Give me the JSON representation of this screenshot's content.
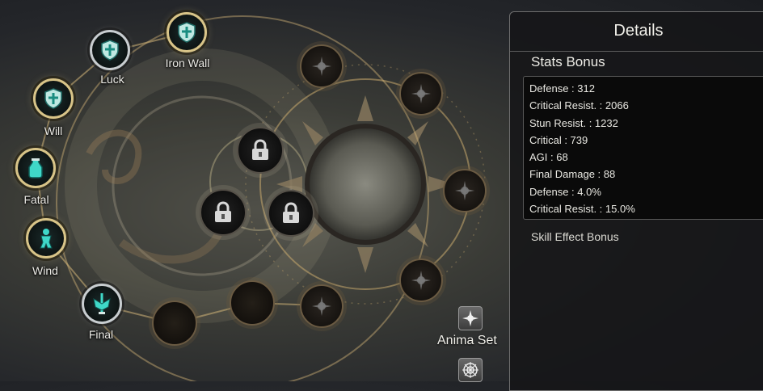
{
  "skill_tree": {
    "unlocked_nodes": [
      {
        "label": "Luck",
        "icon": "shield-cross-icon"
      },
      {
        "label": "Iron Wall",
        "icon": "shield-cross-icon"
      },
      {
        "label": "Will",
        "icon": "shield-cross-icon"
      },
      {
        "label": "Fatal",
        "icon": "vial-icon"
      },
      {
        "label": "Wind",
        "icon": "figure-icon"
      },
      {
        "label": "Final",
        "icon": "sword-wings-icon"
      }
    ],
    "locked_nodes_count": 3,
    "star_nodes_count": 6,
    "moon_nodes_count": 2
  },
  "details": {
    "title": "Details",
    "stats_bonus_label": "Stats Bonus",
    "stats": [
      "Defense : 312",
      "Critical Resist. : 2066",
      "Stun Resist. : 1232",
      "Critical : 739",
      "AGI : 68",
      "Final Damage : 88",
      "Defense : 4.0%",
      "Critical Resist. : 15.0%"
    ],
    "skill_effect_label": "Skill Effect Bonus"
  },
  "anima": {
    "label": "Anima Set"
  },
  "colors": {
    "gold_ring": "#d8c488",
    "teal_icon": "#3fd8c8",
    "panel_bg": "#161618"
  }
}
